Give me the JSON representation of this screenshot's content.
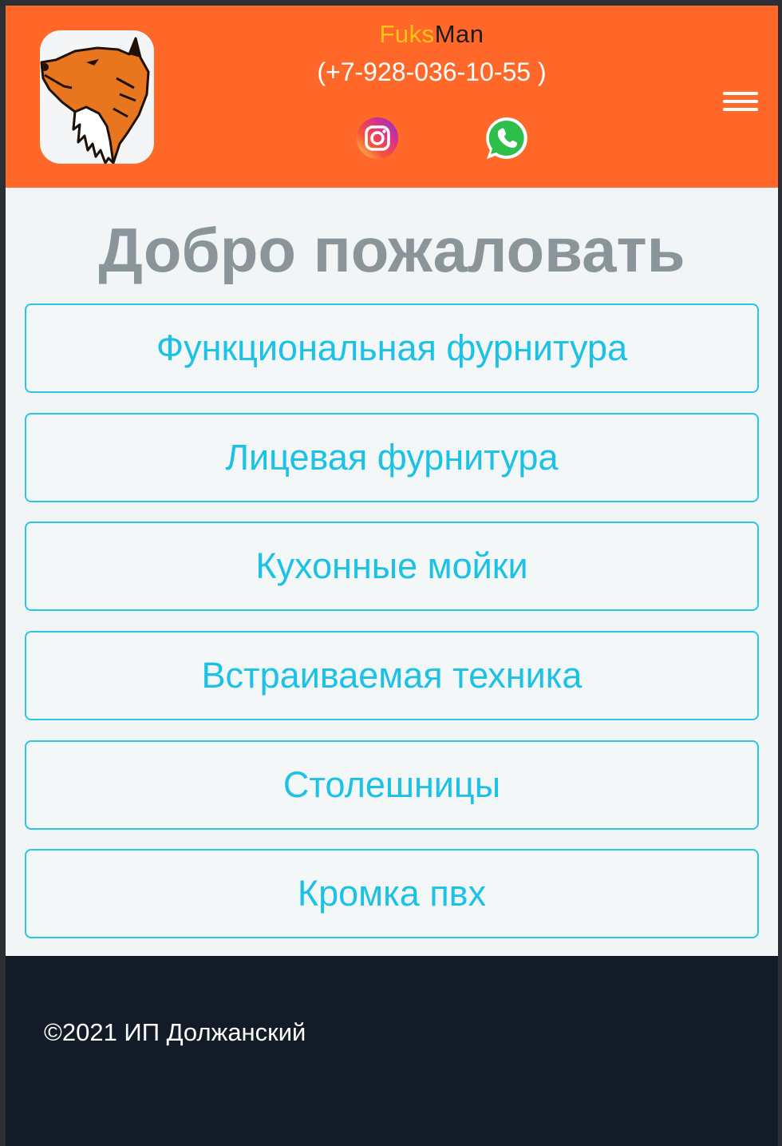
{
  "header": {
    "brand_part1": "Fuks",
    "brand_part2": "Man",
    "phone": "(+7-928-036-10-55 )",
    "logo_icon": "fox-logo-icon",
    "social": [
      {
        "icon": "instagram-icon"
      },
      {
        "icon": "whatsapp-icon"
      }
    ],
    "menu_icon": "hamburger-menu-icon",
    "colors": {
      "background": "#ff6828",
      "brand_accent": "#ffc31a"
    }
  },
  "main": {
    "title": "Добро пожаловать",
    "categories": [
      "Функциональная фурнитура",
      "Лицевая фурнитура",
      "Кухонные мойки",
      "Встраиваемая техника",
      "Столешницы",
      "Кромка пвх"
    ],
    "colors": {
      "button_border": "#29c7e6",
      "button_text": "#1cc1e6",
      "title": "#8a9599"
    }
  },
  "footer": {
    "copyright": "©2021 ИП Должанский",
    "colors": {
      "background": "#121c28"
    }
  }
}
